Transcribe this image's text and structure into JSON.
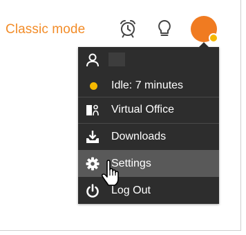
{
  "topbar": {
    "mode_label": "Classic mode",
    "alarm_icon": "alarm-clock-icon",
    "tip_icon": "lightbulb-icon",
    "avatar_color": "#f07b21",
    "status_color": "#f5b800"
  },
  "menu": {
    "user_name": "",
    "status_label": "Idle: 7 minutes",
    "items": [
      {
        "label": "Virtual Office",
        "icon": "virtual-office-icon"
      },
      {
        "label": "Downloads",
        "icon": "download-icon"
      },
      {
        "label": "Settings",
        "icon": "gear-icon",
        "hovered": true
      },
      {
        "label": "Log Out",
        "icon": "power-icon"
      }
    ]
  },
  "colors": {
    "accent": "#f28c28",
    "menu_bg": "#2d2d2d",
    "menu_hover": "#595959",
    "idle": "#f5b800"
  }
}
